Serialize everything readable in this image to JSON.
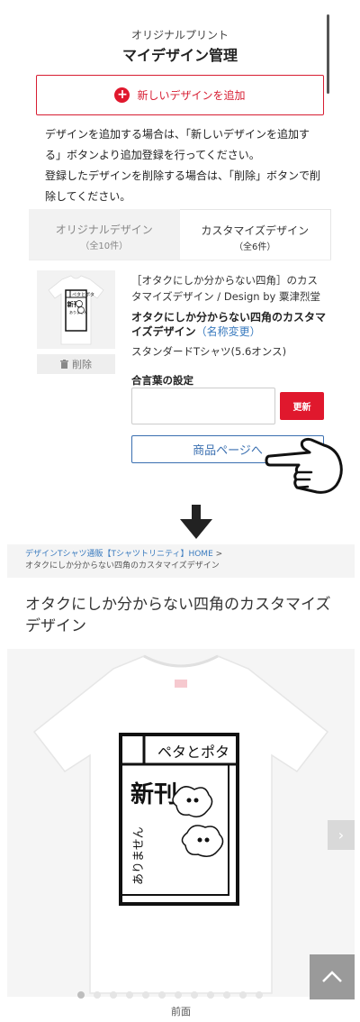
{
  "header": {
    "subtitle": "オリジナルプリント",
    "title": "マイデザイン管理"
  },
  "add_button": {
    "label": "新しいデザインを追加",
    "icon": "plus-circle-icon"
  },
  "notice": {
    "line1": "デザインを追加する場合は、「新しいデザインを追加する」ボタンより追加登録を行ってください。",
    "line2": "登録したデザインを削除する場合は、「削除」ボタンで削除してください。"
  },
  "tabs": [
    {
      "label": "オリジナルデザイン",
      "count": "（全10件）",
      "active": false
    },
    {
      "label": "カスタマイズデザイン",
      "count": "（全6件）",
      "active": true
    }
  ],
  "item": {
    "thumb_text_top": "ペタとポタ",
    "thumb_text_big": "新刊",
    "thumb_text_side": "ありません",
    "delete_label": "削除",
    "description": "［オタクにしか分からない四角］のカスタマイズデザイン / Design by 粟津烈堂",
    "name": "オタクにしか分からない四角のカスタマイズデザイン",
    "rename_label": "（名称変更）",
    "product_type": "スタンダードTシャツ(5.6オンス)",
    "password_label": "合言葉の設定",
    "password_value": "",
    "update_label": "更新",
    "product_page_label": "商品ページへ"
  },
  "product_page": {
    "breadcrumb_link": "デザインTシャツ通販【Tシャツトリニティ】HOME",
    "breadcrumb_sep": " >",
    "breadcrumb_current": "オタクにしか分からない四角のカスタマイズデザイン",
    "title": "オタクにしか分からない四角のカスタマイズデザイン",
    "design_text_top": "ペタとポタ",
    "design_text_big": "新刊",
    "design_text_side": "ありません",
    "next_label": "›",
    "image_count": 12,
    "current_image": 1,
    "caption": "前面"
  },
  "colors": {
    "accent_red": "#e0182d",
    "link_blue": "#3a6fb0",
    "tab_inactive_bg": "#f2f2f2"
  }
}
